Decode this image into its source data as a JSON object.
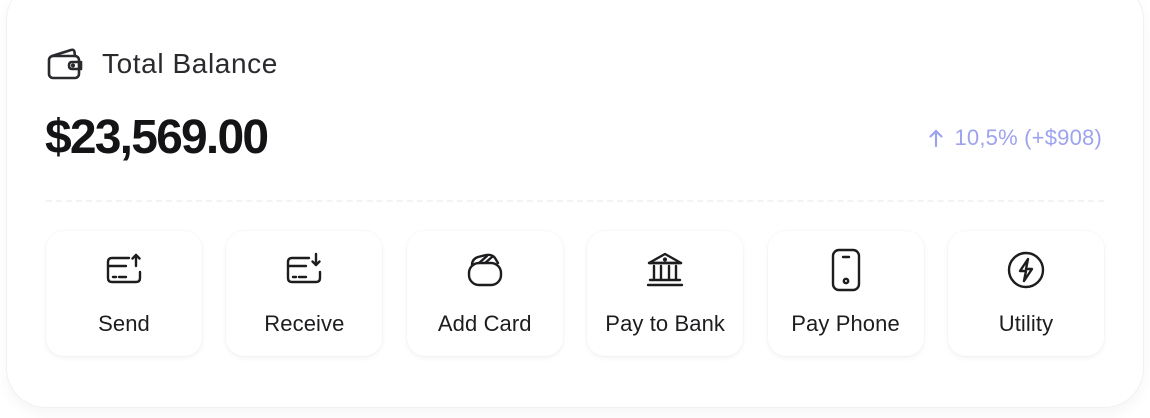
{
  "header": {
    "icon": "wallet-icon",
    "title": "Total Balance"
  },
  "balance": {
    "amount": "$23,569.00"
  },
  "change": {
    "icon": "arrow-up-icon",
    "text": "10,5% (+$908)",
    "color": "#9ea3ee"
  },
  "actions": [
    {
      "label": "Send",
      "icon": "send-card-icon"
    },
    {
      "label": "Receive",
      "icon": "receive-card-icon"
    },
    {
      "label": "Add Card",
      "icon": "add-card-icon"
    },
    {
      "label": "Pay to Bank",
      "icon": "bank-icon"
    },
    {
      "label": "Pay Phone",
      "icon": "phone-icon"
    },
    {
      "label": "Utility",
      "icon": "lightning-icon"
    }
  ]
}
